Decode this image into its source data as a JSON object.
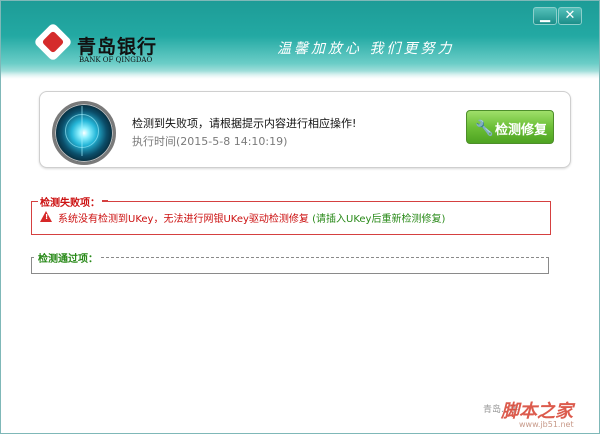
{
  "window": {
    "minimize_icon": "minimize-icon",
    "close_icon": "close-icon",
    "minimize_glyph": "▁",
    "close_glyph": "✕"
  },
  "header": {
    "logo_cn": "青岛银行",
    "logo_en": "BANK OF QINGDAO",
    "slogan": "温馨加放心 我们更努力",
    "colors": {
      "header_teal": "#23a9a3",
      "logo_red": "#d52b2b"
    }
  },
  "status": {
    "message": "检测到失败项，请根据提示内容进行相应操作!",
    "time": "执行时间(2015-5-8 14:10:19)",
    "repair_button": "检测修复",
    "repair_icon": "wrench-icon",
    "repair_glyph": "🔧",
    "colors": {
      "button_green": "#6cbf37"
    }
  },
  "failed_section": {
    "title": "检测失败项：",
    "items": [
      {
        "icon": "warning-icon",
        "glyph": "!",
        "text": "系统没有检测到UKey，无法进行网银UKey驱动检测修复",
        "hint": "(请插入UKey后重新检测修复)"
      }
    ],
    "colors": {
      "error_red": "#cc1111",
      "hint_green": "#2a8a1a"
    }
  },
  "passed_section": {
    "title": "检测通过项："
  },
  "footer": {
    "partial_text": "青岛...手",
    "watermark": "脚本之家",
    "watermark_url": "www.jb51.net"
  }
}
